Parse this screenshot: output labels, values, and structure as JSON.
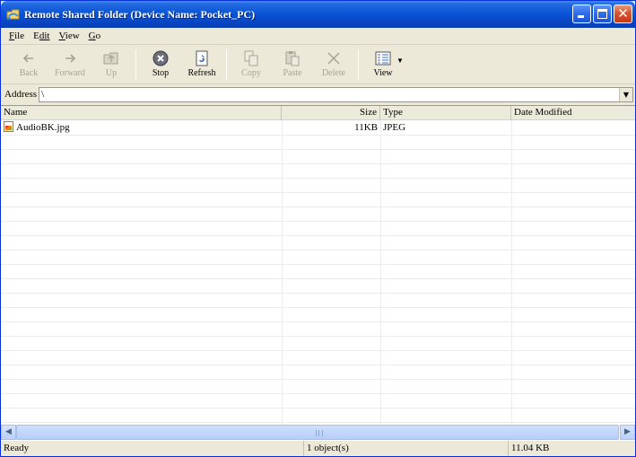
{
  "window": {
    "title": "Remote Shared Folder (Device Name: Pocket_PC)",
    "controls": {
      "minimize": "minimize",
      "maximize": "maximize",
      "close": "close"
    }
  },
  "menu": [
    {
      "key": "F",
      "rest": "ile"
    },
    {
      "key": "E",
      "rest": "dit",
      "prefix": ""
    },
    {
      "key": "V",
      "rest": "iew"
    },
    {
      "key": "G",
      "rest": "o"
    }
  ],
  "toolbar": {
    "back": "Back",
    "forward": "Forward",
    "up": "Up",
    "stop": "Stop",
    "refresh": "Refresh",
    "copy": "Copy",
    "paste": "Paste",
    "delete": "Delete",
    "view": "View"
  },
  "address": {
    "label": "Address",
    "value": "\\"
  },
  "columns": {
    "name": "Name",
    "size": "Size",
    "type": "Type",
    "date": "Date Modified"
  },
  "files": [
    {
      "name": "AudioBK.jpg",
      "size": "11KB",
      "type": "JPEG",
      "date": "",
      "icon": "jpeg-file-icon"
    }
  ],
  "status": {
    "state": "Ready",
    "count": "1 object(s)",
    "size": "11.04 KB"
  },
  "colors": {
    "titlebar": "#0a55d8",
    "chrome": "#ece9d8",
    "close_button": "#d9532f"
  }
}
